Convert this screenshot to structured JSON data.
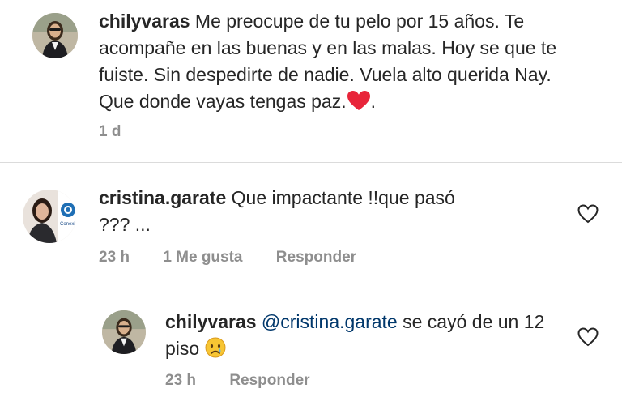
{
  "comments": [
    {
      "username": "chilyvaras",
      "text": "Me preocupe de tu pelo por 15 años. Te acompañe en las buenas y en las malas.  Hoy se que te fuiste. Sin despedirte de nadie.  Vuela alto querida Nay. Que donde vayas tengas paz.",
      "text_after_emoji": ".",
      "emoji": "red-heart",
      "time": "1 d"
    },
    {
      "username": "cristina.garate",
      "text": "Que impactante !!que pasó ??? ...",
      "time": "23 h",
      "likes": "1 Me gusta",
      "reply_label": "Responder"
    },
    {
      "username": "chilyvaras",
      "mention": "@cristina.garate",
      "text": "se cayó de un 12 piso",
      "emoji": "crying-face",
      "time": "23 h",
      "reply_label": "Responder"
    }
  ],
  "avatar_badge_text": "Conexi",
  "colors": {
    "text": "#262626",
    "meta": "#8e8e8e",
    "mention": "#00376b",
    "heart": "#ed4956",
    "divider": "#dbdbdb"
  }
}
